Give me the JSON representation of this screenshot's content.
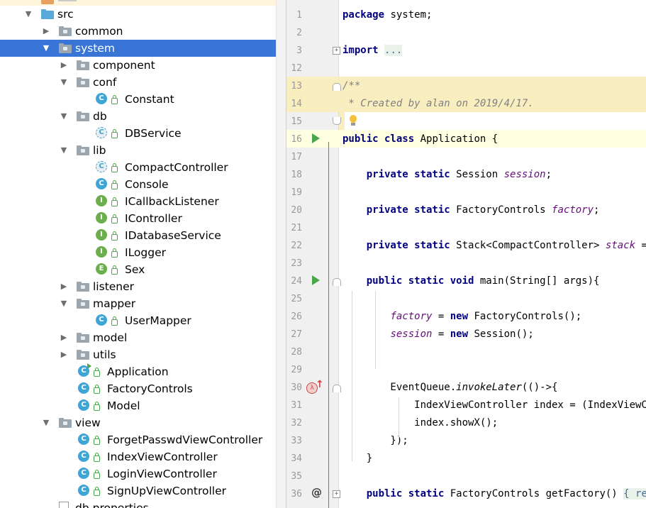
{
  "tree": {
    "items": [
      {
        "label": "src",
        "kind": "src-folder",
        "arrow": "down",
        "depth": 0
      },
      {
        "label": "common",
        "kind": "folder",
        "arrow": "right",
        "depth": 1
      },
      {
        "label": "system",
        "kind": "folder",
        "arrow": "down",
        "depth": 1,
        "selected": true
      },
      {
        "label": "component",
        "kind": "folder",
        "arrow": "right",
        "depth": 2
      },
      {
        "label": "conf",
        "kind": "folder",
        "arrow": "down",
        "depth": 2
      },
      {
        "label": "Constant",
        "kind": "class",
        "letter": "C",
        "depth": 3
      },
      {
        "label": "db",
        "kind": "folder",
        "arrow": "down",
        "depth": 2
      },
      {
        "label": "DBService",
        "kind": "abstract",
        "letter": "C",
        "depth": 3
      },
      {
        "label": "lib",
        "kind": "folder",
        "arrow": "down",
        "depth": 2
      },
      {
        "label": "CompactController",
        "kind": "abstract",
        "letter": "C",
        "depth": 3
      },
      {
        "label": "Console",
        "kind": "class",
        "letter": "C",
        "depth": 3
      },
      {
        "label": "ICallbackListener",
        "kind": "interface",
        "letter": "I",
        "depth": 3
      },
      {
        "label": "IController",
        "kind": "interface",
        "letter": "I",
        "depth": 3
      },
      {
        "label": "IDatabaseService",
        "kind": "interface",
        "letter": "I",
        "depth": 3
      },
      {
        "label": "ILogger",
        "kind": "interface",
        "letter": "I",
        "depth": 3
      },
      {
        "label": "Sex",
        "kind": "enum",
        "letter": "E",
        "depth": 3
      },
      {
        "label": "listener",
        "kind": "folder",
        "arrow": "right",
        "depth": 2
      },
      {
        "label": "mapper",
        "kind": "folder",
        "arrow": "down",
        "depth": 2
      },
      {
        "label": "UserMapper",
        "kind": "class",
        "letter": "C",
        "depth": 3
      },
      {
        "label": "model",
        "kind": "folder",
        "arrow": "right",
        "depth": 2
      },
      {
        "label": "utils",
        "kind": "folder",
        "arrow": "right",
        "depth": 2
      },
      {
        "label": "Application",
        "kind": "class-run",
        "letter": "C",
        "depth": 2
      },
      {
        "label": "FactoryControls",
        "kind": "class",
        "letter": "C",
        "depth": 2
      },
      {
        "label": "Model",
        "kind": "class",
        "letter": "C",
        "depth": 2
      },
      {
        "label": "view",
        "kind": "folder",
        "arrow": "down",
        "depth": 1
      },
      {
        "label": "ForgetPasswdViewController",
        "kind": "class",
        "letter": "C",
        "depth": 2
      },
      {
        "label": "IndexViewController",
        "kind": "class",
        "letter": "C",
        "depth": 2
      },
      {
        "label": "LoginViewController",
        "kind": "class",
        "letter": "C",
        "depth": 2
      },
      {
        "label": "SignUpViewController",
        "kind": "class",
        "letter": "C",
        "depth": 2
      },
      {
        "label": "db.properties",
        "kind": "file",
        "depth": 1
      }
    ]
  },
  "editor": {
    "lines": [
      {
        "n": "1",
        "parts": [
          [
            "kw",
            "package"
          ],
          [
            "t",
            " system;"
          ]
        ]
      },
      {
        "n": "2",
        "parts": []
      },
      {
        "n": "3",
        "parts": [
          [
            "kw",
            "import"
          ],
          [
            "t",
            " "
          ],
          [
            "fold",
            "..."
          ]
        ]
      },
      {
        "n": "12",
        "parts": []
      },
      {
        "n": "13",
        "parts": [
          [
            "cmt",
            "/**"
          ]
        ]
      },
      {
        "n": "14",
        "parts": [
          [
            "cmt",
            " * Created by alan on 2019/4/17."
          ]
        ]
      },
      {
        "n": "15",
        "parts": [
          [
            "cmt",
            " "
          ]
        ]
      },
      {
        "n": "16",
        "parts": [
          [
            "kw",
            "public class"
          ],
          [
            "t",
            " Application {"
          ]
        ]
      },
      {
        "n": "17",
        "parts": []
      },
      {
        "n": "18",
        "parts": [
          [
            "t",
            "    "
          ],
          [
            "kw",
            "private static"
          ],
          [
            "t",
            " Session "
          ],
          [
            "fld",
            "session"
          ],
          [
            "t",
            ";"
          ]
        ]
      },
      {
        "n": "19",
        "parts": []
      },
      {
        "n": "20",
        "parts": [
          [
            "t",
            "    "
          ],
          [
            "kw",
            "private static"
          ],
          [
            "t",
            " FactoryControls "
          ],
          [
            "fld",
            "factory"
          ],
          [
            "t",
            ";"
          ]
        ]
      },
      {
        "n": "21",
        "parts": []
      },
      {
        "n": "22",
        "parts": [
          [
            "t",
            "    "
          ],
          [
            "kw",
            "private static"
          ],
          [
            "t",
            " Stack<CompactController> "
          ],
          [
            "fld",
            "stack"
          ],
          [
            "t",
            " ="
          ]
        ]
      },
      {
        "n": "23",
        "parts": []
      },
      {
        "n": "24",
        "parts": [
          [
            "t",
            "    "
          ],
          [
            "kw",
            "public static void"
          ],
          [
            "t",
            " main(String[] args){"
          ]
        ]
      },
      {
        "n": "25",
        "parts": []
      },
      {
        "n": "26",
        "parts": [
          [
            "t",
            "        "
          ],
          [
            "fld",
            "factory"
          ],
          [
            "t",
            " = "
          ],
          [
            "kw",
            "new"
          ],
          [
            "t",
            " FactoryControls();"
          ]
        ]
      },
      {
        "n": "27",
        "parts": [
          [
            "t",
            "        "
          ],
          [
            "fld",
            "session"
          ],
          [
            "t",
            " = "
          ],
          [
            "kw",
            "new"
          ],
          [
            "t",
            " Session();"
          ]
        ]
      },
      {
        "n": "28",
        "parts": []
      },
      {
        "n": "29",
        "parts": []
      },
      {
        "n": "30",
        "parts": [
          [
            "t",
            "        EventQueue."
          ],
          [
            "it",
            "invokeLater"
          ],
          [
            "t",
            "(()->{"
          ]
        ]
      },
      {
        "n": "31",
        "parts": [
          [
            "t",
            "            IndexViewController index = (IndexViewCont"
          ]
        ]
      },
      {
        "n": "32",
        "parts": [
          [
            "t",
            "            index.showX();"
          ]
        ]
      },
      {
        "n": "33",
        "parts": [
          [
            "t",
            "        });"
          ]
        ]
      },
      {
        "n": "34",
        "parts": [
          [
            "t",
            "    }"
          ]
        ]
      },
      {
        "n": "35",
        "parts": []
      },
      {
        "n": "36",
        "parts": [
          [
            "t",
            "    "
          ],
          [
            "kw",
            "public static"
          ],
          [
            "t",
            " FactoryControls getFactory() "
          ],
          [
            "fold",
            "{ re"
          ]
        ]
      }
    ]
  }
}
